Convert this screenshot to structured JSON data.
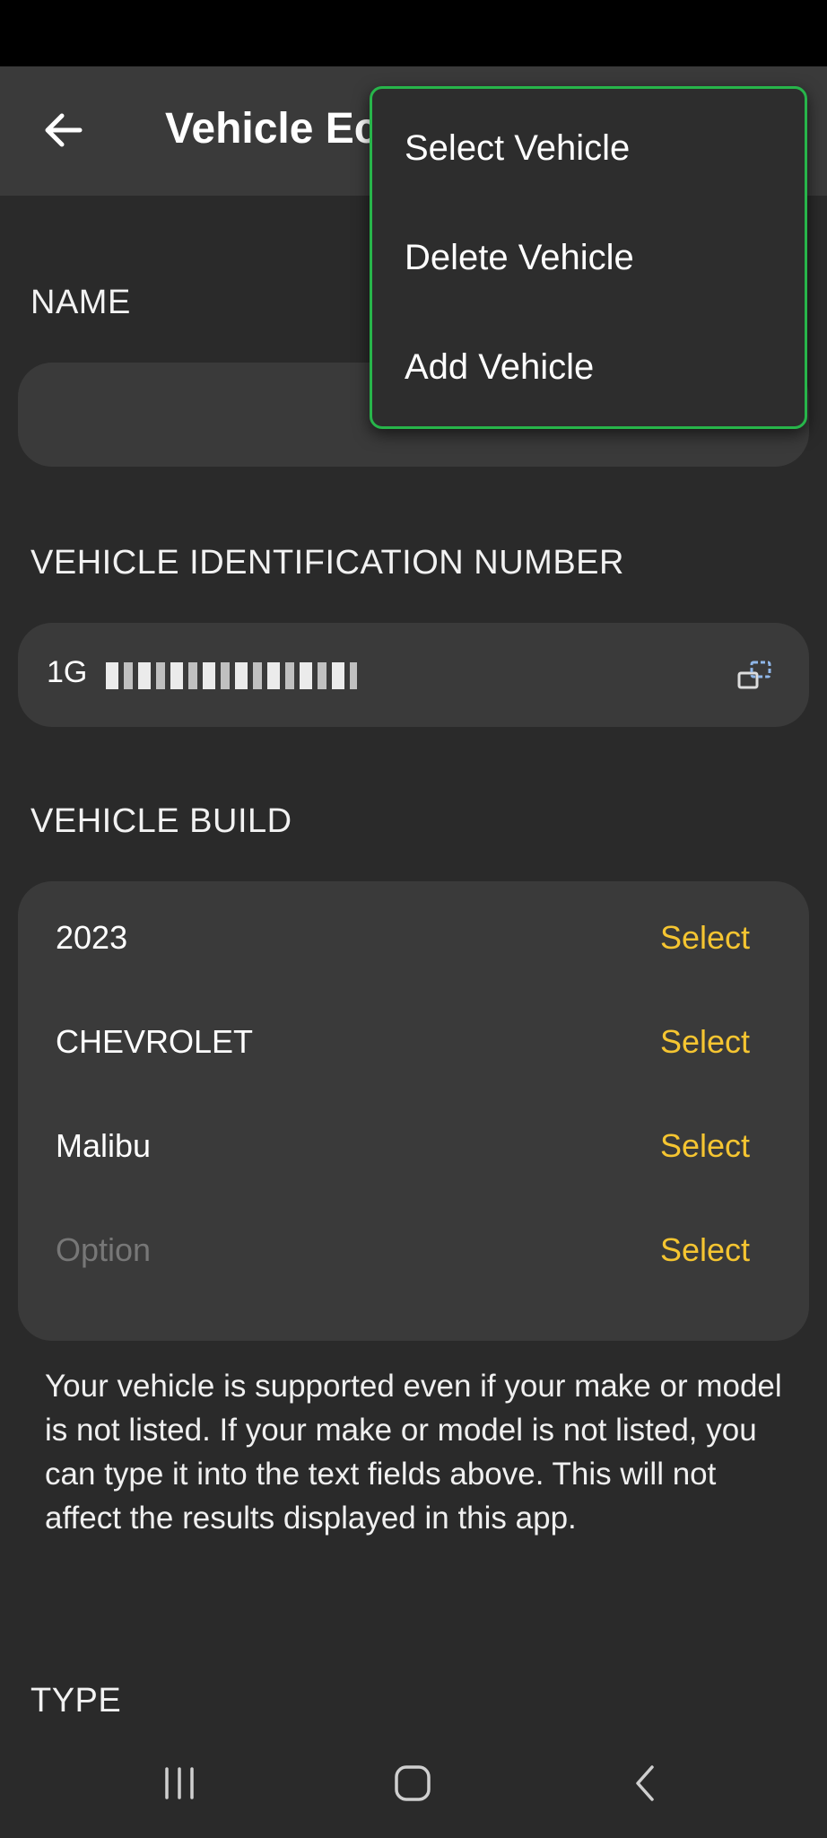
{
  "app_bar": {
    "title": "Vehicle Ec",
    "back_icon": "arrow-left-icon"
  },
  "sections": {
    "name_label": "NAME",
    "name_value": "",
    "vin_label": "VEHICLE IDENTIFICATION NUMBER",
    "vin_value": "1G",
    "build_label": "VEHICLE BUILD",
    "type_label": "TYPE"
  },
  "build": {
    "rows": [
      {
        "value": "2023",
        "action": "Select",
        "placeholder": false
      },
      {
        "value": "CHEVROLET",
        "action": "Select",
        "placeholder": false
      },
      {
        "value": "Malibu",
        "action": "Select",
        "placeholder": false
      },
      {
        "value": "Option",
        "action": "Select",
        "placeholder": true
      }
    ]
  },
  "info_text": "Your vehicle is supported even if your make or model is not listed. If your make or model is not listed, you can type it into the text fields above. This will not affect the results displayed in this app.",
  "menu": {
    "items": [
      "Select Vehicle",
      "Delete Vehicle",
      "Add Vehicle"
    ]
  },
  "colors": {
    "accent_select": "#f5c531",
    "menu_border": "#27b54a",
    "background": "#2a2a2a",
    "field": "#3a3a3a"
  }
}
